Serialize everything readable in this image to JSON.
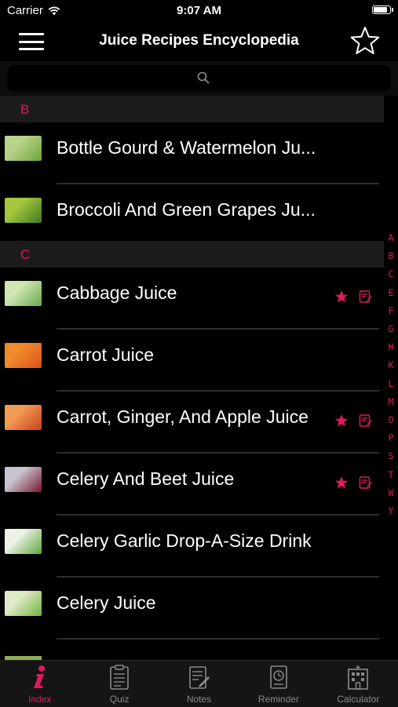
{
  "status_bar": {
    "carrier": "Carrier",
    "time": "9:07 AM",
    "battery_level": 0.92
  },
  "nav": {
    "title": "Juice Recipes Encyclopedia",
    "menu_icon": "hamburger-menu-icon",
    "favorite_icon": "star-outline-icon"
  },
  "search": {
    "placeholder": "",
    "icon": "search-icon"
  },
  "sections": [
    {
      "letter": "B",
      "items": [
        {
          "label": "Bottle Gourd & Watermelon Ju...",
          "favorite": false,
          "note": false,
          "thumb_colors": [
            "#b9d38a",
            "#6fa33d"
          ]
        },
        {
          "label": "Broccoli And Green Grapes Ju...",
          "favorite": false,
          "note": false,
          "thumb_colors": [
            "#a5c63c",
            "#3f7a22"
          ]
        }
      ]
    },
    {
      "letter": "C",
      "items": [
        {
          "label": "Cabbage Juice",
          "favorite": true,
          "note": true,
          "thumb_colors": [
            "#cfe6b4",
            "#6aa84f"
          ]
        },
        {
          "label": "Carrot Juice",
          "favorite": false,
          "note": false,
          "thumb_colors": [
            "#f28b2c",
            "#d94f1a"
          ]
        },
        {
          "label": "Carrot, Ginger, And Apple Juice",
          "favorite": true,
          "note": true,
          "thumb_colors": [
            "#f39a55",
            "#c7421c"
          ]
        },
        {
          "label": "Celery And Beet Juice",
          "favorite": true,
          "note": true,
          "thumb_colors": [
            "#c9c3cf",
            "#7a1730"
          ]
        },
        {
          "label": "Celery Garlic Drop-A-Size Drink",
          "favorite": false,
          "note": false,
          "thumb_colors": [
            "#eef2e6",
            "#5aa63a"
          ]
        },
        {
          "label": "Celery Juice",
          "favorite": false,
          "note": false,
          "thumb_colors": [
            "#dfeac7",
            "#6fb53f"
          ]
        }
      ]
    }
  ],
  "index_letters": [
    "A",
    "B",
    "C",
    "E",
    "F",
    "G",
    "H",
    "K",
    "L",
    "M",
    "O",
    "P",
    "S",
    "T",
    "W",
    "Y"
  ],
  "tabs": [
    {
      "label": "Index",
      "icon": "info-icon",
      "active": true
    },
    {
      "label": "Quiz",
      "icon": "quiz-clipboard-icon",
      "active": false
    },
    {
      "label": "Notes",
      "icon": "notes-icon",
      "active": false
    },
    {
      "label": "Reminder",
      "icon": "reminder-clock-icon",
      "active": false
    },
    {
      "label": "Calculator",
      "icon": "calculator-building-icon",
      "active": false
    }
  ],
  "colors": {
    "accent": "#e0195f",
    "background": "#000000",
    "section_header": "#1c1c1c",
    "tab_bar": "#151515"
  }
}
